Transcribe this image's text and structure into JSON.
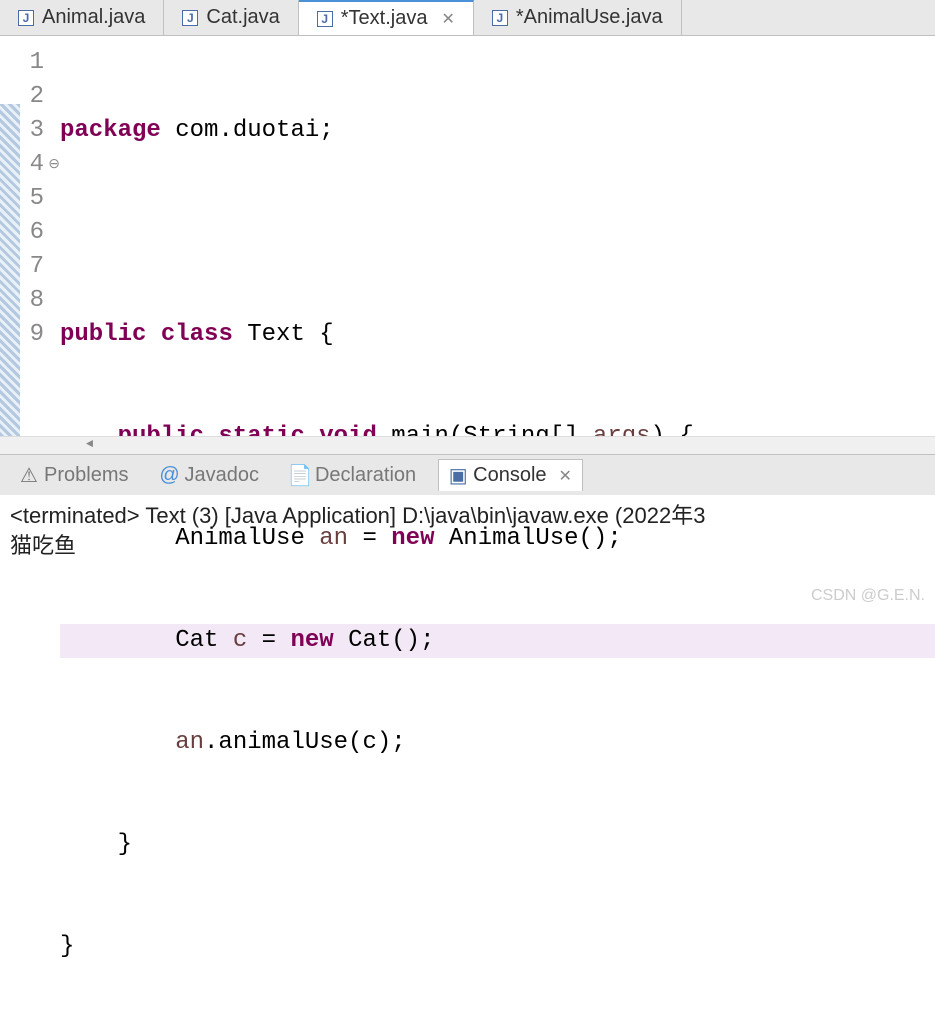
{
  "tabs": [
    {
      "label": "Animal.java",
      "active": false,
      "dirty": false
    },
    {
      "label": "Cat.java",
      "active": false,
      "dirty": false
    },
    {
      "label": "*Text.java",
      "active": true,
      "dirty": true
    },
    {
      "label": "*AnimalUse.java",
      "active": false,
      "dirty": true
    }
  ],
  "editor": {
    "code": {
      "l1": {
        "kw1": "package",
        "rest": " com.duotai;"
      },
      "l3": {
        "kw1": "public",
        "kw2": "class",
        "rest": " Text {"
      },
      "l4": {
        "kw1": "public",
        "kw2": "static",
        "kw3": "void",
        "mid": " main(String[] ",
        "var": "args",
        "end": ") {"
      },
      "l5": {
        "pre": "        AnimalUse ",
        "var": "an",
        "mid": " = ",
        "kw": "new",
        "end": " AnimalUse();"
      },
      "l6": {
        "pre": "        Cat ",
        "var": "c",
        "mid": " = ",
        "kw": "new",
        "end": " Cat();"
      },
      "l7": {
        "pre": "        ",
        "var": "an",
        "end": ".animalUse(c);"
      },
      "l8": "    }",
      "l9": "}"
    },
    "lineNumbers": [
      "1",
      "2",
      "3",
      "4",
      "5",
      "6",
      "7",
      "8",
      "9"
    ],
    "highlightedLine": 6,
    "foldLine": 4
  },
  "bottomTabs": {
    "problems": "Problems",
    "javadoc": "Javadoc",
    "declaration": "Declaration",
    "console": "Console"
  },
  "console": {
    "status": "<terminated> Text (3) [Java Application] D:\\java\\bin\\javaw.exe (2022年3",
    "output": "猫吃鱼"
  },
  "watermark": "CSDN @G.E.N."
}
